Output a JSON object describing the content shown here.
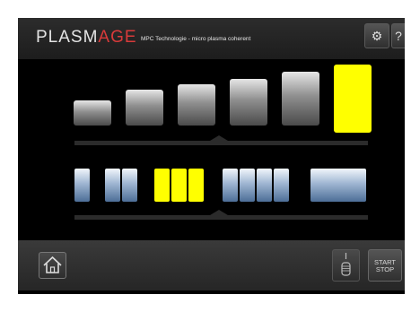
{
  "header": {
    "brand_main": "PLASM",
    "brand_accent": "AGE",
    "tagline": "MPC Technologie - micro plasma coherent",
    "settings_icon": "gear-icon",
    "help_label": "?"
  },
  "level_selector": {
    "count": 6,
    "selected_level": 6
  },
  "mode_selector": {
    "groups": [
      {
        "segments": 1,
        "active": false
      },
      {
        "segments": 2,
        "active": false
      },
      {
        "segments": 3,
        "active": true
      },
      {
        "segments": 4,
        "active": false
      },
      {
        "segments": 1,
        "active": false
      }
    ]
  },
  "footer": {
    "home_icon": "home-icon",
    "mouse_icon": "mouse-icon",
    "start_label": "START",
    "stop_label": "STOP"
  },
  "colors": {
    "active": "#ffff00",
    "brand_accent": "#d83a3a",
    "background": "#000000"
  }
}
